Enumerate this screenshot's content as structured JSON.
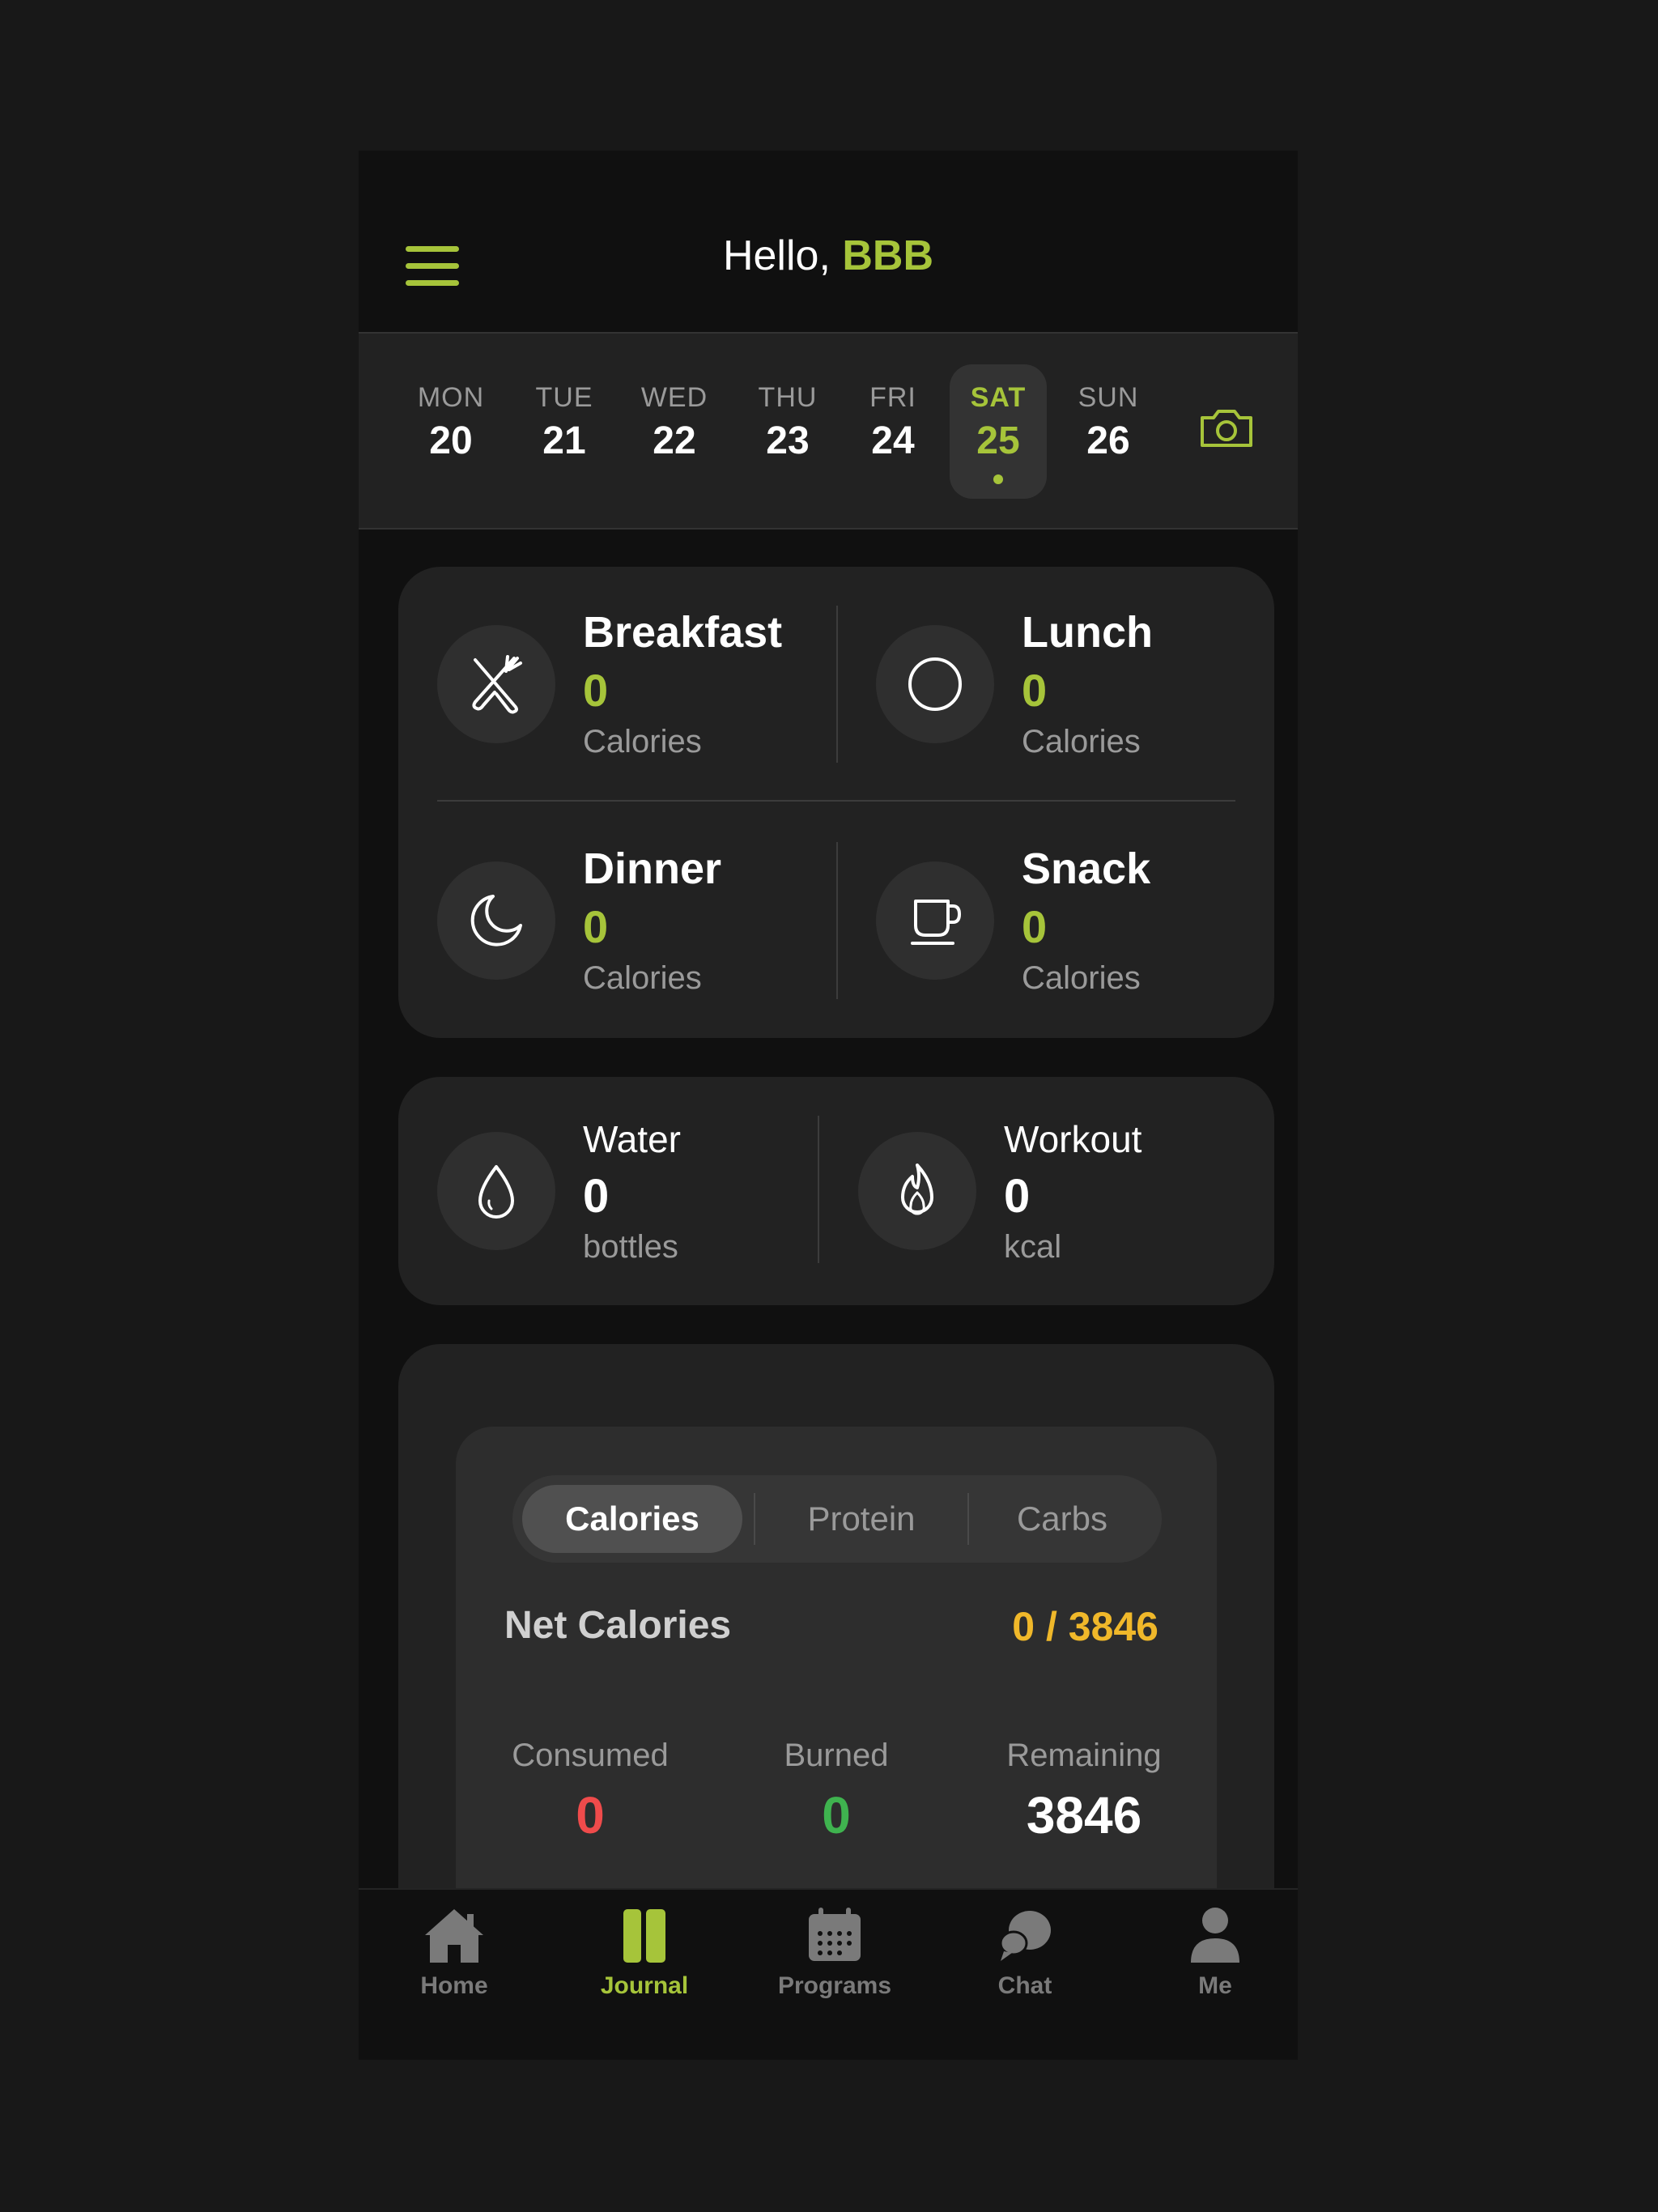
{
  "header": {
    "greeting": "Hello,",
    "name": "BBB"
  },
  "week": {
    "days": [
      {
        "name": "MON",
        "date": "20"
      },
      {
        "name": "TUE",
        "date": "21"
      },
      {
        "name": "WED",
        "date": "22"
      },
      {
        "name": "THU",
        "date": "23"
      },
      {
        "name": "FRI",
        "date": "24"
      },
      {
        "name": "SAT",
        "date": "25"
      },
      {
        "name": "SUN",
        "date": "26"
      }
    ],
    "selected_day": "SAT",
    "camera_icon": "camera-icon"
  },
  "meals": [
    {
      "title": "Breakfast",
      "value": "0",
      "unit": "Calories",
      "icon": "fork-knife-icon"
    },
    {
      "title": "Lunch",
      "value": "0",
      "unit": "Calories",
      "icon": "plate-icon"
    },
    {
      "title": "Dinner",
      "value": "0",
      "unit": "Calories",
      "icon": "moon-icon"
    },
    {
      "title": "Snack",
      "value": "0",
      "unit": "Calories",
      "icon": "cup-icon"
    }
  ],
  "tracking": [
    {
      "title": "Water",
      "value": "0",
      "unit": "bottles",
      "icon": "water-drop-icon"
    },
    {
      "title": "Workout",
      "value": "0",
      "unit": "kcal",
      "icon": "flame-icon"
    }
  ],
  "nutrition": {
    "tabs": [
      "Calories",
      "Protein",
      "Carbs"
    ],
    "active_tab": "Calories",
    "net_label": "Net Calories",
    "net_value": "0 / 3846",
    "stats": [
      {
        "label": "Consumed",
        "value": "0",
        "color": "#ef4b4b"
      },
      {
        "label": "Burned",
        "value": "0",
        "color": "#3fb34f"
      },
      {
        "label": "Remaining",
        "value": "3846",
        "color": "#ffffff"
      }
    ]
  },
  "tabbar": [
    {
      "label": "Home",
      "icon": "home-icon"
    },
    {
      "label": "Journal",
      "icon": "journal-icon"
    },
    {
      "label": "Programs",
      "icon": "calendar-icon"
    },
    {
      "label": "Chat",
      "icon": "chat-icon"
    },
    {
      "label": "Me",
      "icon": "person-icon"
    }
  ],
  "colors": {
    "accent": "#a6c43a",
    "background": "#181818",
    "card": "#222222",
    "net_value": "#f0b82a"
  }
}
